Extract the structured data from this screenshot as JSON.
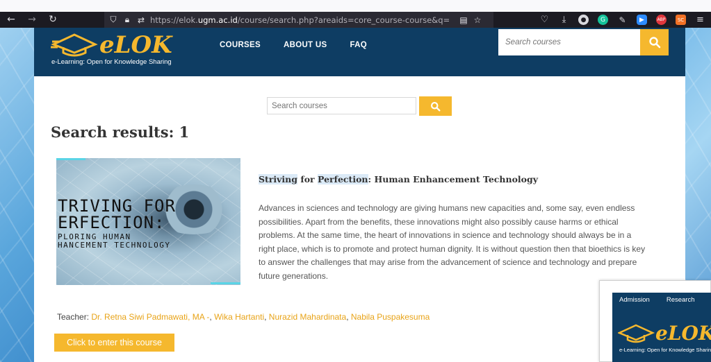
{
  "browser": {
    "url_prefix": "https://elok.",
    "url_host": "ugm.ac.id",
    "url_rest": "/course/search.php?areaids=core_course-course&q=Striving+for+...",
    "extensions": [
      "pocket-icon",
      "download-icon",
      "account-icon",
      "grammarly-icon",
      "pen-icon",
      "zoom-icon",
      "abp-icon",
      "sc-icon"
    ],
    "ext_labels": {
      "abp": "ABP",
      "sc": "SC",
      "grammarly": "G"
    }
  },
  "site": {
    "logo_text": "eLOK",
    "tagline": "e-Learning: Open for Knowledge Sharing",
    "nav": [
      "COURSES",
      "ABOUT US",
      "FAQ"
    ],
    "header_search_placeholder": "Search courses",
    "brand_color": "#0e3d63",
    "accent_color": "#f5b82e"
  },
  "search": {
    "placeholder": "Search courses",
    "results_title": "Search results: 1"
  },
  "course": {
    "image_lines": [
      "TRIVING FOR",
      "ERFECTION:",
      "PLORING HUMAN",
      "HANCEMENT TECHNOLOGY"
    ],
    "title_hl1": "Striving",
    "title_mid": " for ",
    "title_hl2": "Perfection",
    "title_rest": ": Human Enhancement Technology",
    "description": "Advances in sciences and technology are giving humans new capacities and, some say, even endless possibilities. Apart from the benefits, these innovations might also possibly cause harms or ethical problems. At the same time, the heart of innovations in science and technology should always be in a right place, which is to promote and protect human dignity. It is without question then that bioethics is key to answer the challenges that may arise from the advancement of science and technology and prepare future generations.",
    "teacher_label": "Teacher: ",
    "teachers": [
      "Dr. Retna Siwi Padmawati, MA -",
      "Wika Hartanti",
      "Nurazid Mahardinata",
      "Nabila Puspakesuma"
    ],
    "enter_label": "Click to enter this course"
  },
  "preview": {
    "nav": [
      "Admission",
      "Research"
    ],
    "logo_text": "eLOK",
    "tagline": "e-Learning: Open for Knowledge Sharing"
  }
}
